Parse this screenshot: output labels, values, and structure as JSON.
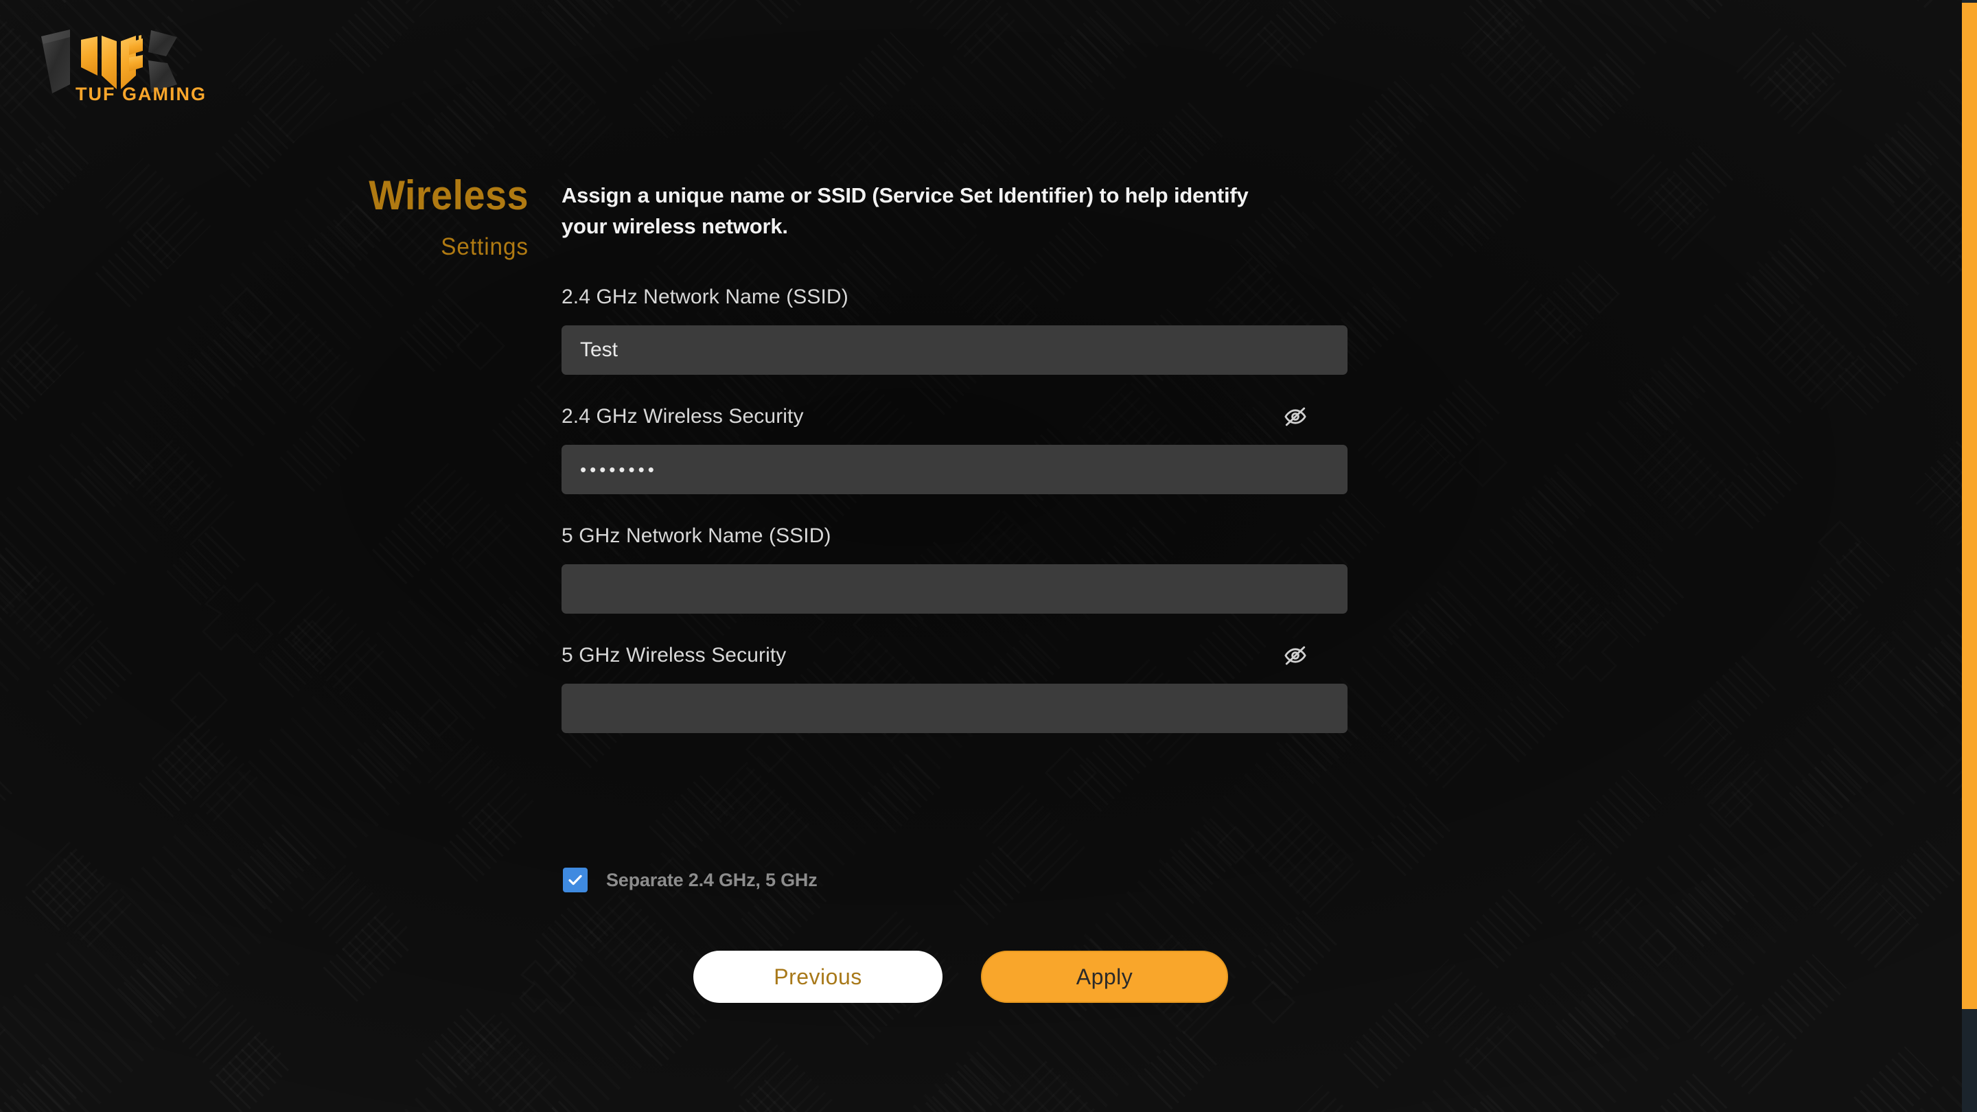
{
  "brand": {
    "logo_text": "TUF GAMING",
    "logo_mark": "tuf-shield-mark",
    "accent_color": "#f9a62b",
    "gold_color": "#b07a12"
  },
  "header": {
    "title": "Wireless",
    "subtitle": "Settings",
    "description": "Assign a unique name or SSID (Service Set Identifier) to help identify your wireless network."
  },
  "form": {
    "fields": [
      {
        "id": "ssid-24",
        "label": "2.4 GHz Network Name (SSID)",
        "value": "Test",
        "placeholder": "",
        "type": "text",
        "has_visibility_toggle": false
      },
      {
        "id": "security-24",
        "label": "2.4 GHz Wireless Security",
        "value": "••••••••",
        "placeholder": "",
        "type": "password",
        "has_visibility_toggle": true,
        "visibility_icon": "eye-off-icon"
      },
      {
        "id": "ssid-5",
        "label": "5 GHz Network Name (SSID)",
        "value": "",
        "placeholder": "",
        "type": "text",
        "has_visibility_toggle": false
      },
      {
        "id": "security-5",
        "label": "5 GHz Wireless Security",
        "value": "",
        "placeholder": "",
        "type": "password",
        "has_visibility_toggle": true,
        "visibility_icon": "eye-off-icon"
      }
    ],
    "separate_bands": {
      "label": "Separate 2.4 GHz, 5 GHz",
      "checked": true,
      "checkbox_color": "#3f8ae0"
    }
  },
  "actions": {
    "previous_label": "Previous",
    "apply_label": "Apply"
  },
  "scrollbar": {
    "thumb_color": "#f9a62b",
    "track_color": "#1b242c"
  }
}
